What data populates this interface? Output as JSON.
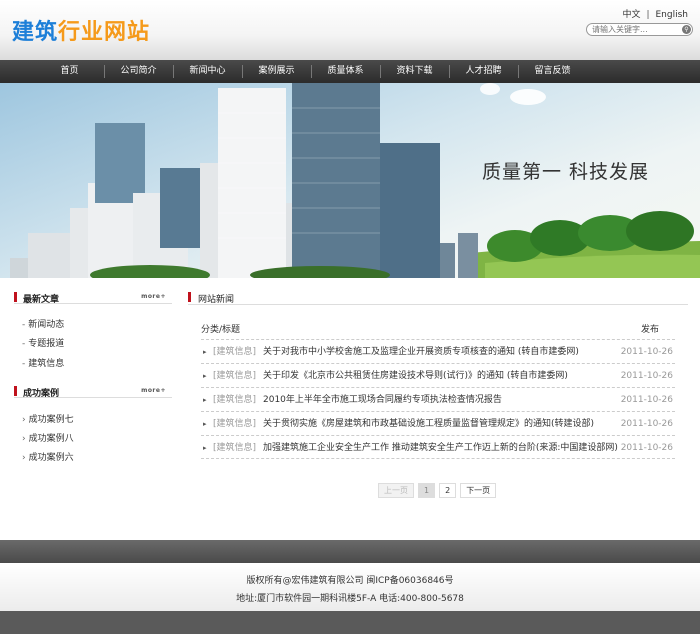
{
  "header": {
    "logo_part1": "建筑",
    "logo_part2": "行业网站",
    "lang_cn": "中文",
    "lang_sep": "|",
    "lang_en": "English",
    "search_placeholder": "请输入关键字..."
  },
  "nav": [
    "首页",
    "公司简介",
    "新闻中心",
    "案例展示",
    "质量体系",
    "资料下载",
    "人才招聘",
    "留言反馈"
  ],
  "banner": {
    "slogan": "质量第一   科技发展"
  },
  "sidebar": {
    "articles_title": "最新文章",
    "more_label": "more+",
    "articles": [
      "新闻动态",
      "专题报道",
      "建筑信息"
    ],
    "cases_title": "成功案例",
    "cases_more_label": "more+",
    "cases": [
      "成功案例七",
      "成功案例八",
      "成功案例六"
    ]
  },
  "main": {
    "title": "网站新闻",
    "col_category": "分类/标题",
    "col_date": "发布",
    "news": [
      {
        "cat": "[建筑信息]",
        "title": "关于对我市中小学校舍施工及监理企业开展资质专项核查的通知 (转自市建委网)",
        "date": "2011-10-26"
      },
      {
        "cat": "[建筑信息]",
        "title": "关于印发《北京市公共租赁住房建设技术导则(试行)》的通知 (转自市建委网)",
        "date": "2011-10-26"
      },
      {
        "cat": "[建筑信息]",
        "title": "2010年上半年全市施工现场合同履约专项执法检查情况报告",
        "date": "2011-10-26"
      },
      {
        "cat": "[建筑信息]",
        "title": "关于贯彻实施《房屋建筑和市政基础设施工程质量监督管理规定》的通知(转建设部)",
        "date": "2011-10-26"
      },
      {
        "cat": "[建筑信息]",
        "title": "加强建筑施工企业安全生产工作  推动建筑安全生产工作迈上新的台阶(来源:中国建设部网)",
        "date": "2011-10-26"
      }
    ],
    "pager": {
      "prev": "上一页",
      "page1": "1",
      "page2": "2",
      "next": "下一页"
    }
  },
  "footer": {
    "copyright": "版权所有@宏伟建筑有限公司  闽ICP备06036846号",
    "address": "地址:厦门市软件园一期科讯楼5F-A 电话:400-800-5678"
  },
  "colors": {
    "accent_red": "#c0121d",
    "nav_bg": "#333333",
    "logo_blue": "#1d7fd8",
    "logo_orange": "#f59a1b"
  }
}
